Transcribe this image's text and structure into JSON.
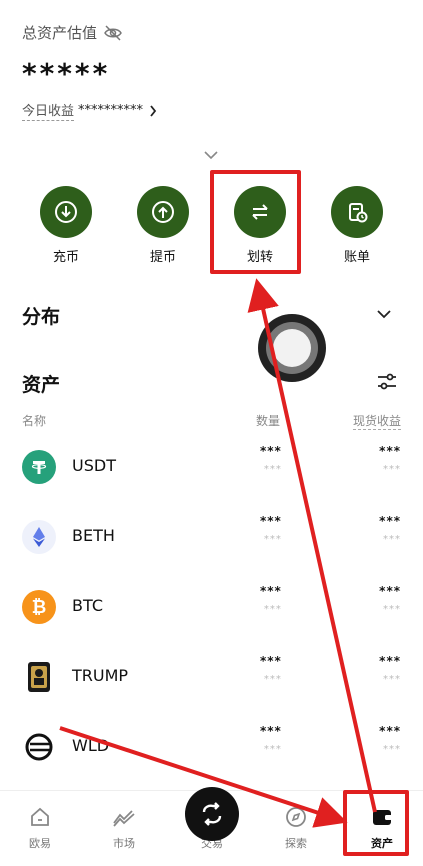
{
  "header": {
    "total_label": "总资产估值",
    "total_value": "*****",
    "today_label": "今日收益",
    "today_value": "**********"
  },
  "actions": [
    {
      "label": "充币",
      "icon": "deposit-icon"
    },
    {
      "label": "提币",
      "icon": "withdraw-icon"
    },
    {
      "label": "划转",
      "icon": "transfer-icon"
    },
    {
      "label": "账单",
      "icon": "bill-icon"
    }
  ],
  "distribution": {
    "title": "分布"
  },
  "assets_section": {
    "title": "资产",
    "col_name": "名称",
    "col_qty": "数量",
    "col_pnl": "现货收益"
  },
  "assets": [
    {
      "name": "USDT",
      "qty": "***",
      "qty_sub": "***",
      "pnl": "***",
      "pnl_sub": "***",
      "color": "#26a17b"
    },
    {
      "name": "BETH",
      "qty": "***",
      "qty_sub": "***",
      "pnl": "***",
      "pnl_sub": "***",
      "color": "#627eea"
    },
    {
      "name": "BTC",
      "qty": "***",
      "qty_sub": "***",
      "pnl": "***",
      "pnl_sub": "***",
      "color": "#f7931a"
    },
    {
      "name": "TRUMP",
      "qty": "***",
      "qty_sub": "***",
      "pnl": "***",
      "pnl_sub": "***",
      "color": "#c9a24a"
    },
    {
      "name": "WLD",
      "qty": "***",
      "qty_sub": "***",
      "pnl": "***",
      "pnl_sub": "***",
      "color": "#111111"
    }
  ],
  "nav": [
    {
      "label": "欧易",
      "icon": "home-icon"
    },
    {
      "label": "市场",
      "icon": "market-icon"
    },
    {
      "label": "交易",
      "icon": "trade-icon"
    },
    {
      "label": "探索",
      "icon": "explore-icon"
    },
    {
      "label": "资产",
      "icon": "wallet-icon"
    }
  ],
  "colors": {
    "accent_green": "#2e5e1b",
    "highlight_red": "#e02020"
  }
}
